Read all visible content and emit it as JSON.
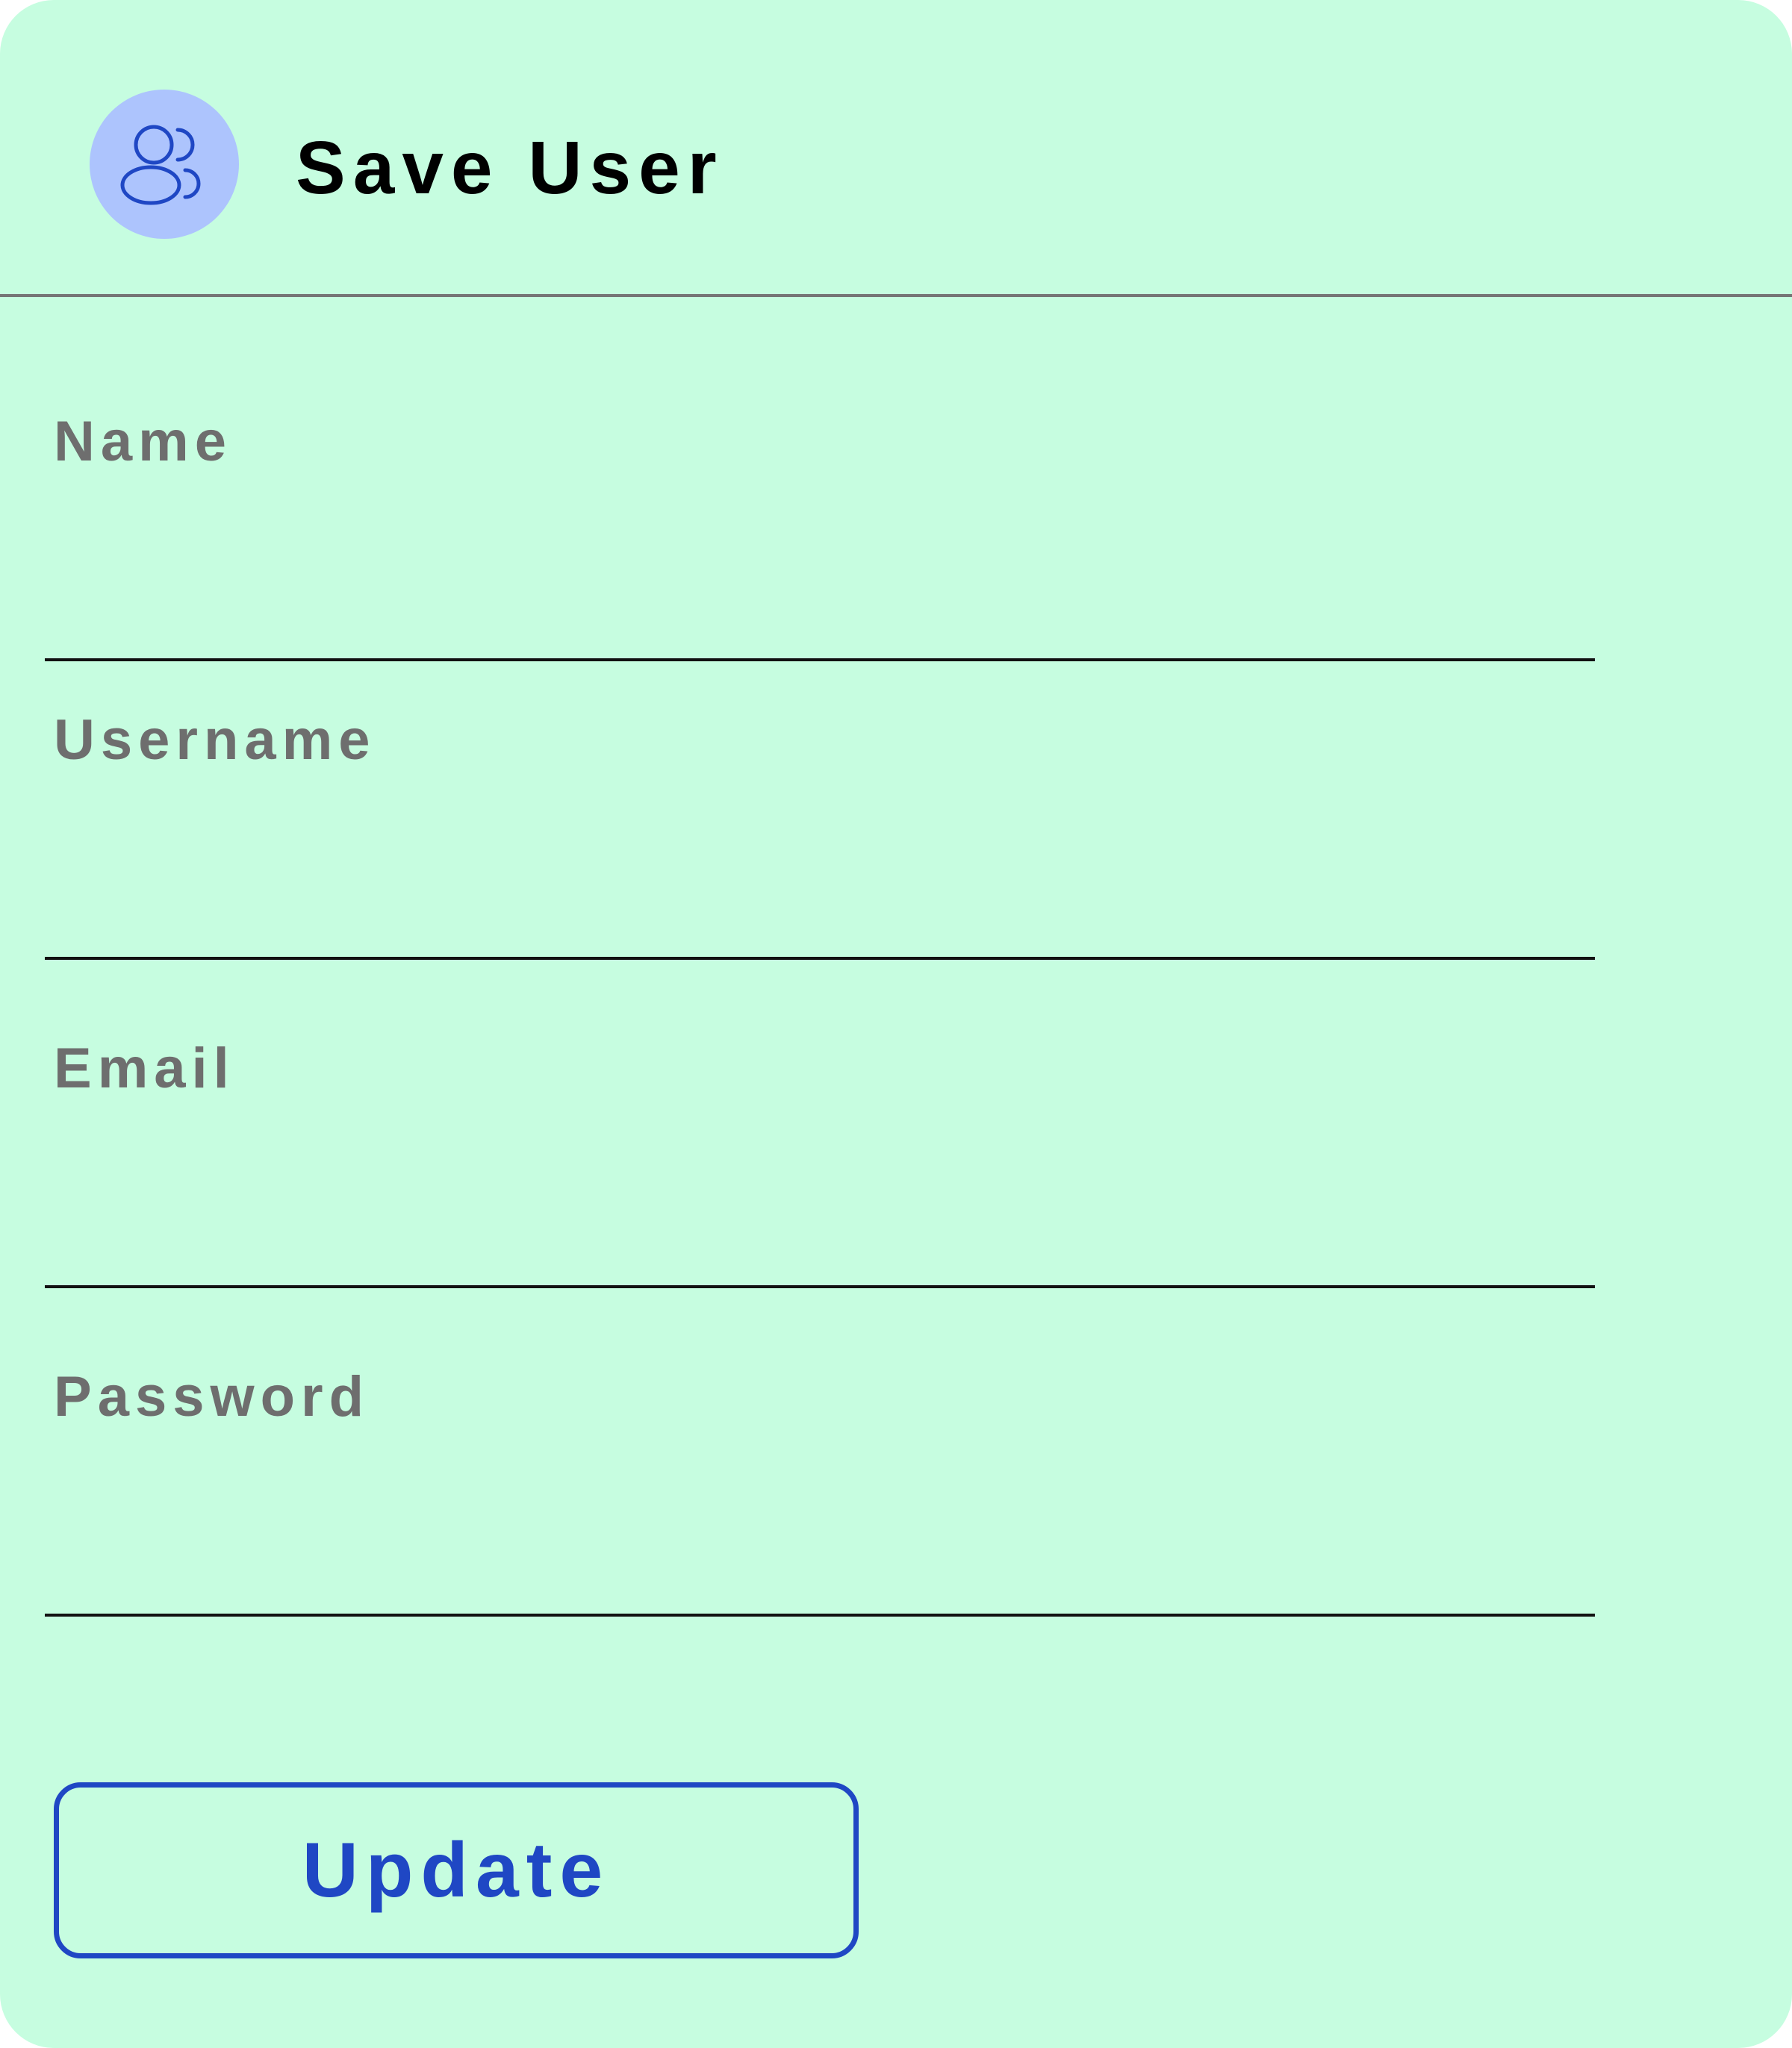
{
  "header": {
    "title": "Save User",
    "icon": "users-icon"
  },
  "form": {
    "fields": [
      {
        "label": "Name",
        "value": ""
      },
      {
        "label": "Username",
        "value": ""
      },
      {
        "label": "Email",
        "value": ""
      },
      {
        "label": "Password",
        "value": ""
      }
    ],
    "submit_label": "Update"
  },
  "colors": {
    "background": "#c6fde0",
    "accent": "#1f47c4",
    "avatar_bg": "#adc4fd",
    "label": "#6e6e6e",
    "divider": "#757575"
  }
}
